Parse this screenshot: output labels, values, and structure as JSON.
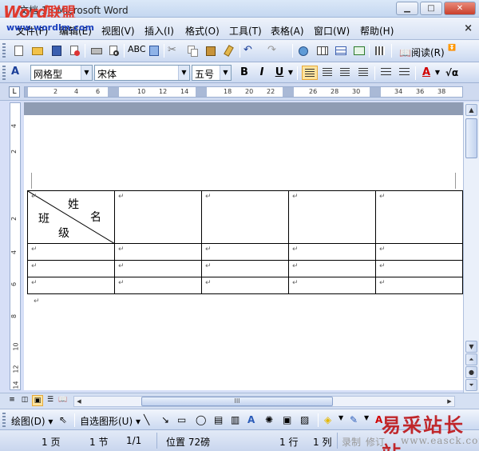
{
  "window": {
    "title": "文档 1 - Microsoft Word",
    "logo_word": "Word",
    "logo_union": "联盟",
    "logo_url": "www.wordlm.com"
  },
  "menu": {
    "items": [
      "文件(F)",
      "编辑(E)",
      "视图(V)",
      "插入(I)",
      "格式(O)",
      "工具(T)",
      "表格(A)",
      "窗口(W)",
      "帮助(H)"
    ]
  },
  "toolbar": {
    "read_label": "阅读(R)",
    "style": "网格型",
    "font": "宋体",
    "size": "五号",
    "bold": "B",
    "italic": "I",
    "underline": "U",
    "font_color_label": "A"
  },
  "ruler": {
    "corner": "L",
    "numbers": [
      "2",
      "4",
      "6",
      "10",
      "12",
      "14",
      "18",
      "20",
      "22",
      "26",
      "28",
      "30",
      "34",
      "36",
      "38"
    ],
    "vertical_numbers": [
      "4",
      "2",
      "2",
      "4",
      "6",
      "8",
      "10",
      "12",
      "14"
    ]
  },
  "table": {
    "header_diag": {
      "top_right_1": "姓",
      "top_right_2": "名",
      "bottom_left_1": "班",
      "bottom_left_2": "级"
    },
    "paragraph_mark": "↵"
  },
  "draw_toolbar": {
    "draw_label": "绘图(D)",
    "autoshape_label": "自选图形(U)"
  },
  "hscroll": {
    "thumb_label": "III"
  },
  "status": {
    "page": "1 页",
    "section": "1 节",
    "page_of": "1/1",
    "position": "位置 72磅",
    "line": "1 行",
    "column": "1 列",
    "record": "录制",
    "revise": "修订"
  },
  "watermark": {
    "text": "易采站长站",
    "url": "www.easck.com"
  }
}
